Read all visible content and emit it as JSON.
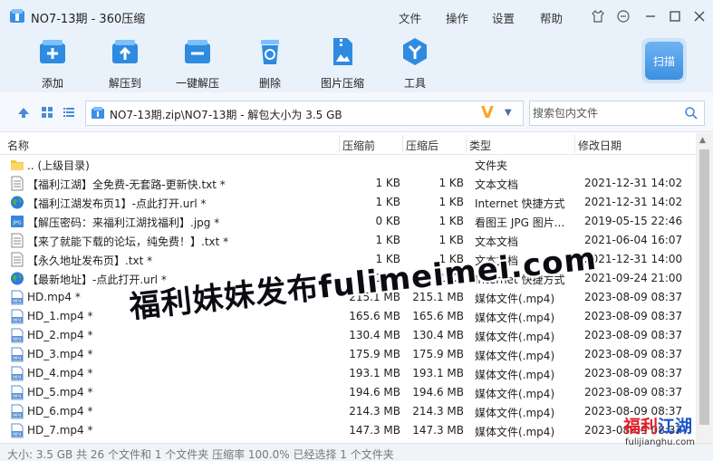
{
  "window": {
    "title": "NO7-13期 - 360压缩"
  },
  "menu": [
    "文件",
    "操作",
    "设置",
    "帮助"
  ],
  "toolbar": [
    {
      "label": "添加",
      "icon": "add-icon"
    },
    {
      "label": "解压到",
      "icon": "extract-to-icon"
    },
    {
      "label": "一键解压",
      "icon": "one-click-extract-icon"
    },
    {
      "label": "删除",
      "icon": "delete-icon"
    },
    {
      "label": "图片压缩",
      "icon": "image-compress-icon"
    },
    {
      "label": "工具",
      "icon": "tools-icon"
    }
  ],
  "scan": {
    "label": "扫描"
  },
  "address": {
    "path": "NO7-13期.zip\\NO7-13期 - 解包大小为 3.5 GB",
    "search_placeholder": "搜索包内文件"
  },
  "columns": {
    "name": "名称",
    "size": "压缩前",
    "packed": "压缩后",
    "type": "类型",
    "date": "修改日期"
  },
  "files": [
    {
      "icon": "folder",
      "name": ".. (上级目录)",
      "size": "",
      "packed": "",
      "type": "文件夹",
      "date": ""
    },
    {
      "icon": "txt",
      "name": "【福利江湖】全免费-无套路-更新快.txt *",
      "size": "1 KB",
      "packed": "1 KB",
      "type": "文本文档",
      "date": "2021-12-31 14:02"
    },
    {
      "icon": "url",
      "name": "【福利江湖发布页1】-点此打开.url *",
      "size": "1 KB",
      "packed": "1 KB",
      "type": "Internet 快捷方式",
      "date": "2021-12-31 14:02"
    },
    {
      "icon": "jpg",
      "name": "【解压密码：来福利江湖找福利】.jpg *",
      "size": "0 KB",
      "packed": "1 KB",
      "type": "看图王 JPG 图片...",
      "date": "2019-05-15 22:46"
    },
    {
      "icon": "txt",
      "name": "【来了就能下载的论坛，纯免费！】.txt *",
      "size": "1 KB",
      "packed": "1 KB",
      "type": "文本文档",
      "date": "2021-06-04 16:07"
    },
    {
      "icon": "txt",
      "name": "【永久地址发布页】.txt *",
      "size": "1 KB",
      "packed": "1 KB",
      "type": "文本文档",
      "date": "2021-12-31 14:00"
    },
    {
      "icon": "url",
      "name": "【最新地址】-点此打开.url *",
      "size": "1 KB",
      "packed": "1 KB",
      "type": "Internet 快捷方式",
      "date": "2021-09-24 21:00"
    },
    {
      "icon": "mp4",
      "name": "HD.mp4 *",
      "size": "215.1 MB",
      "packed": "215.1 MB",
      "type": "媒体文件(.mp4)",
      "date": "2023-08-09 08:37"
    },
    {
      "icon": "mp4",
      "name": "HD_1.mp4 *",
      "size": "165.6 MB",
      "packed": "165.6 MB",
      "type": "媒体文件(.mp4)",
      "date": "2023-08-09 08:37"
    },
    {
      "icon": "mp4",
      "name": "HD_2.mp4 *",
      "size": "130.4 MB",
      "packed": "130.4 MB",
      "type": "媒体文件(.mp4)",
      "date": "2023-08-09 08:37"
    },
    {
      "icon": "mp4",
      "name": "HD_3.mp4 *",
      "size": "175.9 MB",
      "packed": "175.9 MB",
      "type": "媒体文件(.mp4)",
      "date": "2023-08-09 08:37"
    },
    {
      "icon": "mp4",
      "name": "HD_4.mp4 *",
      "size": "193.1 MB",
      "packed": "193.1 MB",
      "type": "媒体文件(.mp4)",
      "date": "2023-08-09 08:37"
    },
    {
      "icon": "mp4",
      "name": "HD_5.mp4 *",
      "size": "194.6 MB",
      "packed": "194.6 MB",
      "type": "媒体文件(.mp4)",
      "date": "2023-08-09 08:37"
    },
    {
      "icon": "mp4",
      "name": "HD_6.mp4 *",
      "size": "214.3 MB",
      "packed": "214.3 MB",
      "type": "媒体文件(.mp4)",
      "date": "2023-08-09 08:37"
    },
    {
      "icon": "mp4",
      "name": "HD_7.mp4 *",
      "size": "147.3 MB",
      "packed": "147.3 MB",
      "type": "媒体文件(.mp4)",
      "date": "2023-08-09 08:37"
    }
  ],
  "status": {
    "text": "大小: 3.5 GB 共 26 个文件和 1 个文件夹 压缩率 100.0% 已经选择 1 个文件夹"
  },
  "watermark": {
    "text": "福利妹妹发布fulimeimei.com"
  },
  "corner_logo": {
    "main_red": "福利",
    "main_blue": "江湖",
    "sub": "fulijianghu.com"
  },
  "colors": {
    "accent": "#2f8be0",
    "titlebar_bg": "#e9f2fb",
    "watermark_red": "#e0202a",
    "watermark_blue": "#1c55c9"
  }
}
